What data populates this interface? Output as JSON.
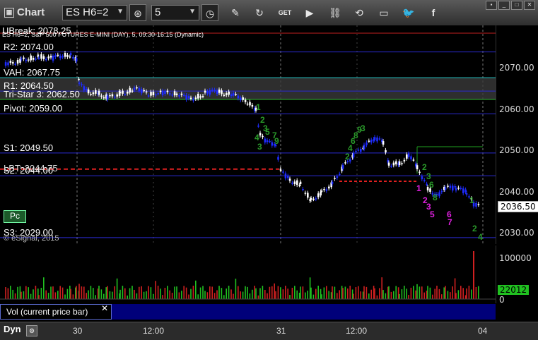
{
  "toolbar": {
    "title": "Chart",
    "symbol": "ES H6=2",
    "interval": "5",
    "buttons": [
      "target-icon",
      "clock-icon",
      "pencil-icon",
      "cycle-icon",
      "get-icon",
      "play-icon",
      "link-icon",
      "comment-icon",
      "twitter-icon",
      "facebook-icon"
    ]
  },
  "chart": {
    "header": "ES H6=2, S&P 500 FUTURES E-MINI (DAY), 5, 09:30-16:15 (Dynamic)",
    "ubreak_label": "UBreak: 2078.25",
    "copyright": "© eSignal, 2015",
    "pc_label": "Pc",
    "levels": [
      {
        "label": "R2: 2074.00",
        "price": 2074.0,
        "color": "#2b2bd0"
      },
      {
        "label": "VAH: 2067.75",
        "price": 2067.75,
        "color": "#20c0c0"
      },
      {
        "label": "R1: 2064.50",
        "price": 2064.5,
        "color": "#2b2bd0"
      },
      {
        "label": "Tri-Star 3: 2062.50",
        "price": 2062.5,
        "color": "#30c030"
      },
      {
        "label": "Pivot: 2059.00",
        "price": 2059.0,
        "color": "#2b2bd0"
      },
      {
        "label": "S1: 2049.50",
        "price": 2049.5,
        "color": "#2b2bd0"
      },
      {
        "label": "S2: 2044.00",
        "price": 2044.0,
        "color": "#2b2bd0"
      },
      {
        "label": "S3: 2029.00",
        "price": 2029.0,
        "color": "#2b2bd0"
      }
    ],
    "lbt_label": "LBT: 2044.75",
    "current_price": "2036.50",
    "price_ticks": [
      "2070.00",
      "2060.00",
      "2050.00",
      "2040.00",
      "2030.00"
    ]
  },
  "volume": {
    "current": "22012",
    "ticks": [
      "100000",
      "0"
    ],
    "study_label": "Vol (current price bar)"
  },
  "time_axis": {
    "labels": [
      "30",
      "12:00",
      "31",
      "12:00",
      "04"
    ],
    "dyn_label": "Dyn"
  },
  "colors": {
    "up_candle": "#ffffff",
    "down_candle": "#1e2cff",
    "volume_up": "#20c020",
    "volume_down": "#d02020",
    "sequence_green": "#2a9a2a",
    "sequence_magenta": "#e020e0"
  }
}
